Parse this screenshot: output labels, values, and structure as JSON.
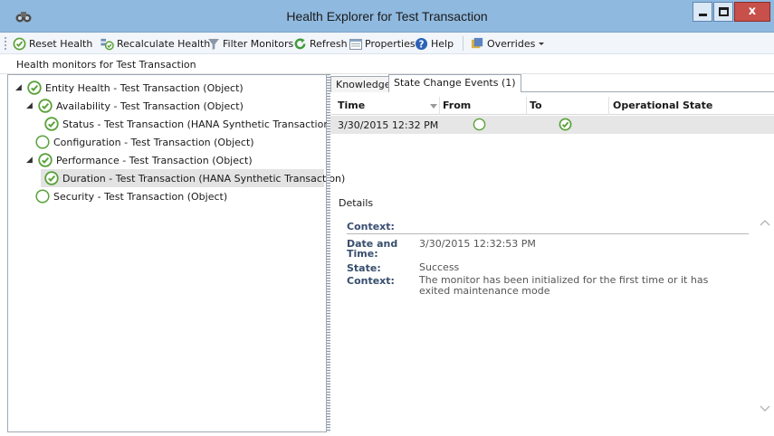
{
  "window": {
    "title": "Health Explorer for Test Transaction",
    "minimize_glyph": "",
    "maximize_glyph": "",
    "close_glyph": "x"
  },
  "toolbar": {
    "items": [
      {
        "label": "Reset Health",
        "icon": "check-circle-icon"
      },
      {
        "label": "Recalculate Health",
        "icon": "recalculate-icon"
      },
      {
        "label": "Filter Monitors",
        "icon": "filter-icon"
      },
      {
        "label": "Refresh",
        "icon": "refresh-icon"
      },
      {
        "label": "Properties",
        "icon": "properties-icon"
      },
      {
        "label": "Help",
        "icon": "help-icon"
      },
      {
        "label": "Overrides",
        "icon": "overrides-icon"
      }
    ]
  },
  "header": {
    "text": "Health monitors for Test Transaction"
  },
  "tree": {
    "items": [
      {
        "label": "Entity Health - Test Transaction (Object)",
        "state": "success",
        "expanded": true
      },
      {
        "label": "Availability - Test Transaction (Object)",
        "state": "success",
        "expanded": true
      },
      {
        "label": "Status - Test Transaction (HANA Synthetic Transaction)",
        "state": "success"
      },
      {
        "label": "Configuration - Test Transaction (Object)",
        "state": "empty"
      },
      {
        "label": "Performance - Test Transaction (Object)",
        "state": "success",
        "expanded": true
      },
      {
        "label": "Duration - Test Transaction (HANA Synthetic Transaction)",
        "state": "success",
        "selected": true
      },
      {
        "label": "Security - Test Transaction (Object)",
        "state": "empty"
      }
    ]
  },
  "tabs": [
    {
      "label": "Knowledge",
      "active": false
    },
    {
      "label": "State Change Events (1)",
      "active": true
    }
  ],
  "grid": {
    "columns": [
      "Time",
      "From",
      "To",
      "Operational State"
    ],
    "rows": [
      {
        "time": "3/30/2015 12:32 PM",
        "from": "empty",
        "to": "success",
        "operational_state": ""
      }
    ]
  },
  "details": {
    "label": "Details",
    "context_header": "Context:",
    "fields": [
      {
        "key": "Date and Time:",
        "value": "3/30/2015 12:32:53 PM"
      },
      {
        "key": "State:",
        "value": "Success"
      },
      {
        "key": "Context:",
        "value": "The monitor has been initialized for the first time or it has exited maintenance mode"
      }
    ]
  },
  "colors": {
    "success": "#5aa23a",
    "title_bar": "#8fb9df",
    "close_button": "#c7504b"
  }
}
